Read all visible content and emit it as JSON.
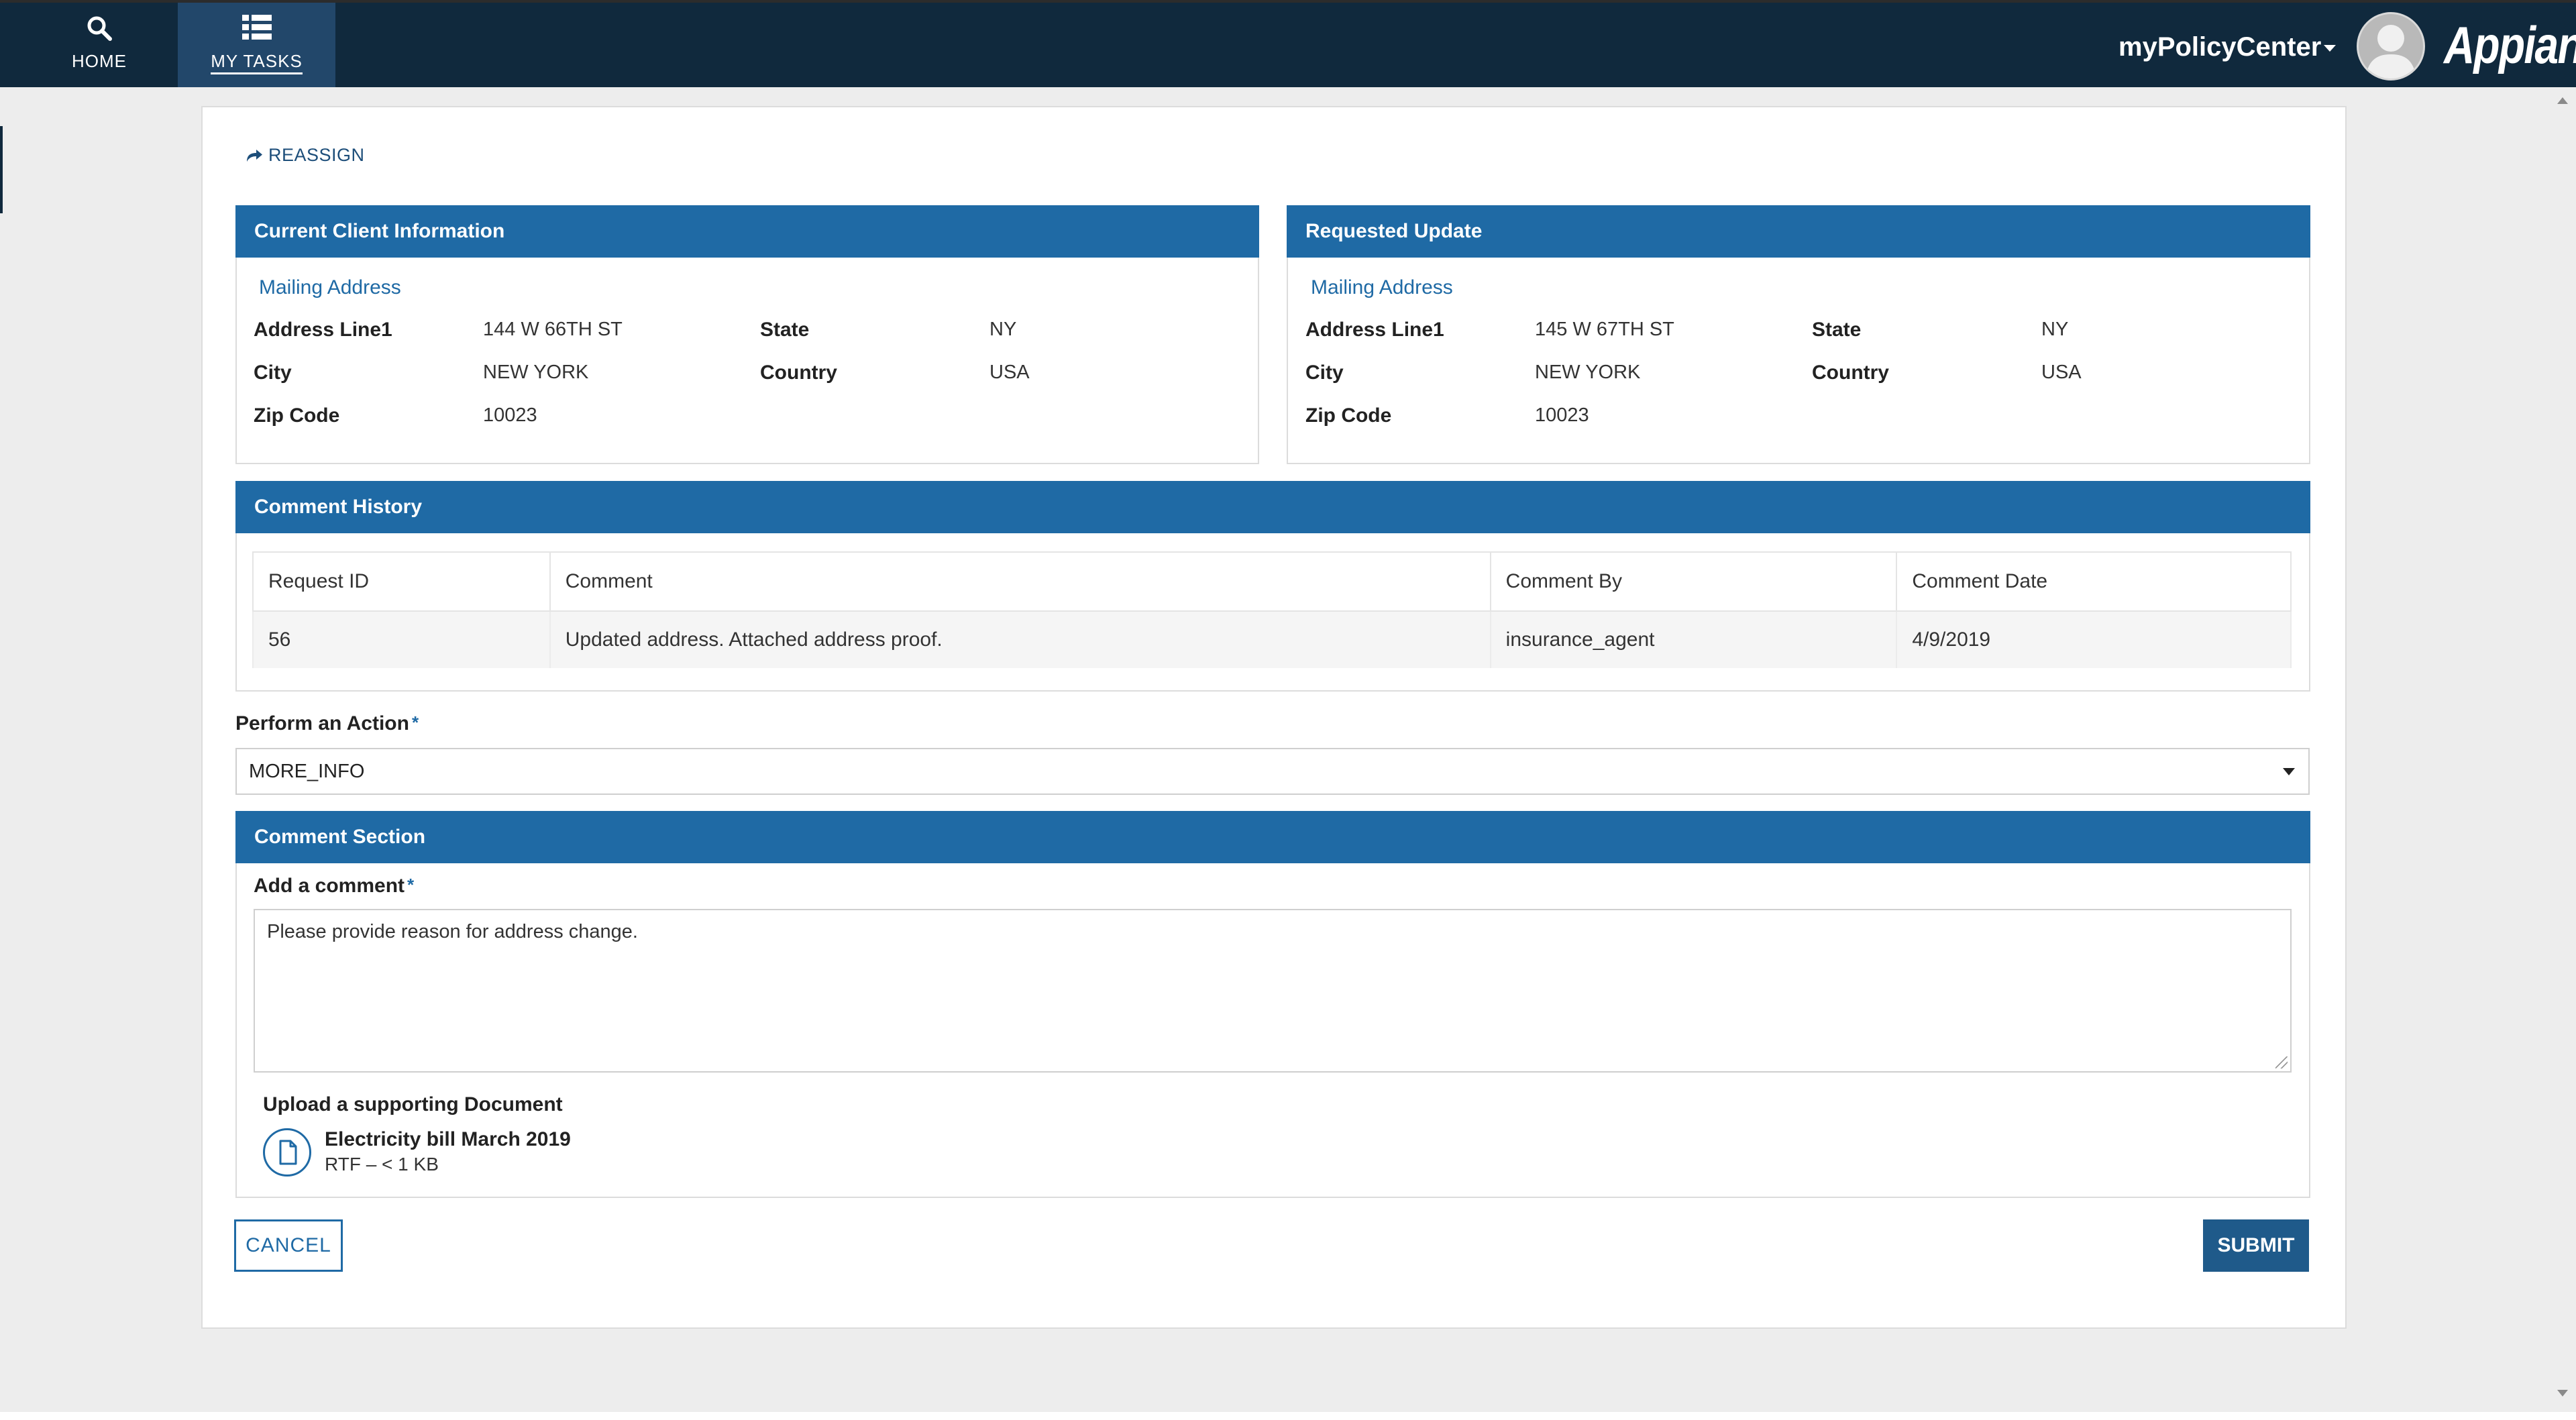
{
  "nav": {
    "home_label": "HOME",
    "tasks_label": "MY TASKS",
    "site_name": "myPolicyCenter",
    "logo_text": "Appian"
  },
  "toolbar": {
    "reassign_label": "REASSIGN"
  },
  "current_client": {
    "title": "Current Client Information",
    "section_label": "Mailing Address",
    "fields": {
      "address_line1_label": "Address Line1",
      "address_line1": "144 W 66TH ST",
      "city_label": "City",
      "city": "NEW YORK",
      "zip_label": "Zip Code",
      "zip": "10023",
      "state_label": "State",
      "state": "NY",
      "country_label": "Country",
      "country": "USA"
    }
  },
  "requested_update": {
    "title": "Requested Update",
    "section_label": "Mailing Address",
    "fields": {
      "address_line1_label": "Address Line1",
      "address_line1": "145 W 67TH ST",
      "city_label": "City",
      "city": "NEW YORK",
      "zip_label": "Zip Code",
      "zip": "10023",
      "state_label": "State",
      "state": "NY",
      "country_label": "Country",
      "country": "USA"
    }
  },
  "comment_history": {
    "title": "Comment History",
    "columns": [
      "Request ID",
      "Comment",
      "Comment By",
      "Comment Date"
    ],
    "rows": [
      [
        "56",
        "Updated address. Attached address proof.",
        "insurance_agent",
        "4/9/2019"
      ]
    ]
  },
  "action": {
    "label": "Perform an Action",
    "required_mark": "*",
    "selected": "MORE_INFO"
  },
  "comment_section": {
    "title": "Comment Section",
    "comment_label": "Add a comment",
    "required_mark": "*",
    "comment_value": "Please provide reason for address change.",
    "upload_label": "Upload a supporting Document",
    "file_name": "Electricity bill March 2019",
    "file_meta": "RTF – < 1 KB"
  },
  "buttons": {
    "cancel": "CANCEL",
    "submit": "SUBMIT"
  },
  "colors": {
    "nav_bg": "#10293d",
    "header_blue": "#1f6aa5",
    "submit_bg": "#1f5a8a"
  }
}
